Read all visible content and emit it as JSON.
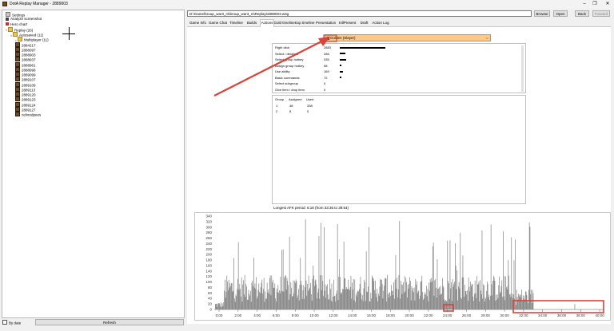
{
  "window": {
    "title": "DotA Replay Manager - 2889003",
    "controls": [
      "–",
      "❐",
      "✕"
    ]
  },
  "tree": {
    "items": [
      {
        "label": "Settings",
        "icon": "settings-icon",
        "depth": 0
      },
      {
        "label": "Analyze screenshot",
        "icon": "camera-icon",
        "depth": 0
      },
      {
        "label": "Hero chart",
        "icon": "chart-icon",
        "depth": 0
      },
      {
        "label": "Replay (26)",
        "icon": "folder-icon",
        "depth": 0
      },
      {
        "label": "Autosaved (11)",
        "icon": "folder-icon",
        "depth": 1
      },
      {
        "label": "Multiplayer (11)",
        "icon": "folder-icon",
        "depth": 2
      },
      {
        "label": "2884217",
        "icon": "replay-icon",
        "depth": 2
      },
      {
        "label": "2888097",
        "icon": "replay-icon",
        "depth": 2
      },
      {
        "label": "2888903",
        "icon": "replay-icon",
        "depth": 2
      },
      {
        "label": "2888937",
        "icon": "replay-icon",
        "depth": 2
      },
      {
        "label": "2888961",
        "icon": "replay-icon",
        "depth": 2
      },
      {
        "label": "2888996",
        "icon": "replay-icon",
        "depth": 2
      },
      {
        "label": "2889099",
        "icon": "replay-icon",
        "depth": 2
      },
      {
        "label": "2889107",
        "icon": "replay-icon",
        "depth": 2
      },
      {
        "label": "2889109",
        "icon": "replay-icon",
        "depth": 2
      },
      {
        "label": "2889113",
        "icon": "replay-icon",
        "depth": 2
      },
      {
        "label": "2889120",
        "icon": "replay-icon",
        "depth": 2
      },
      {
        "label": "2889123",
        "icon": "replay-icon",
        "depth": 2
      },
      {
        "label": "2889124",
        "icon": "replay-icon",
        "depth": 2
      },
      {
        "label": "2889127",
        "icon": "replay-icon",
        "depth": 2
      },
      {
        "label": "celvredpees",
        "icon": "replay-icon",
        "depth": 2
      }
    ]
  },
  "footer": {
    "by_date_label": "By date",
    "refresh_label": "Refresh"
  },
  "toolbar": {
    "path_value": "D:\\Game\\broup_war3_rs\\broup_war3_rs\\Replay\\2889003.w3g",
    "buttons": [
      "Browse",
      "Open",
      "Back",
      "Forward"
    ]
  },
  "tabs": [
    "Game Info",
    "Game Chat",
    "Timeline",
    "Builds",
    "Actions",
    "Gold timeline",
    "Exp timeline",
    "Presentation",
    "KillPresent",
    "Draft",
    "Action Log"
  ],
  "active_tab": "Actions",
  "player_select": {
    "value": "Golden (Slayer)",
    "color": "#fbc98b"
  },
  "stats": {
    "rows": [
      {
        "label": "Right click",
        "value": "2883",
        "frac": 0.6
      },
      {
        "label": "Select / deselect",
        "value": "286",
        "frac": 0.07
      },
      {
        "label": "Select group hotkey",
        "value": "335",
        "frac": 0.08
      },
      {
        "label": "Assign group hotkey",
        "value": "58",
        "frac": 0.015
      },
      {
        "label": "Use ability",
        "value": "169",
        "frac": 0.045
      },
      {
        "label": "Basic commands",
        "value": "72",
        "frac": 0.02
      },
      {
        "label": "Select subgroup",
        "value": "0",
        "frac": 0
      },
      {
        "label": "Give item / drop item",
        "value": "0",
        "frac": 0
      }
    ]
  },
  "groups": {
    "headers": [
      "Group",
      "Assigned",
      "Used"
    ],
    "rows": [
      [
        "1",
        "48",
        "338"
      ],
      [
        "2",
        "8",
        "0"
      ]
    ]
  },
  "apm_text": "Longest AFK period: 6:18 (from 33:36 to 39:54)",
  "chart_data": {
    "type": "bar",
    "y_ticks": [
      "340",
      "320",
      "300",
      "280",
      "260",
      "240",
      "220",
      "200",
      "180",
      "160",
      "140",
      "120",
      "100",
      "80",
      "60",
      "40",
      "20",
      "0"
    ],
    "x_ticks": [
      "0:00",
      "2:00",
      "4:00",
      "6:00",
      "8:00",
      "10:00",
      "12:00",
      "14:00",
      "16:00",
      "18:00",
      "20:00",
      "22:00",
      "24:00",
      "26:00",
      "28:00",
      "30:00",
      "32:00",
      "34:00",
      "36:00",
      "38:00",
      "40:00"
    ],
    "ylim": [
      0,
      340
    ],
    "xlim_minutes": [
      0,
      41
    ],
    "bar_color": "#808080",
    "highlight_color": "#d9433a"
  }
}
